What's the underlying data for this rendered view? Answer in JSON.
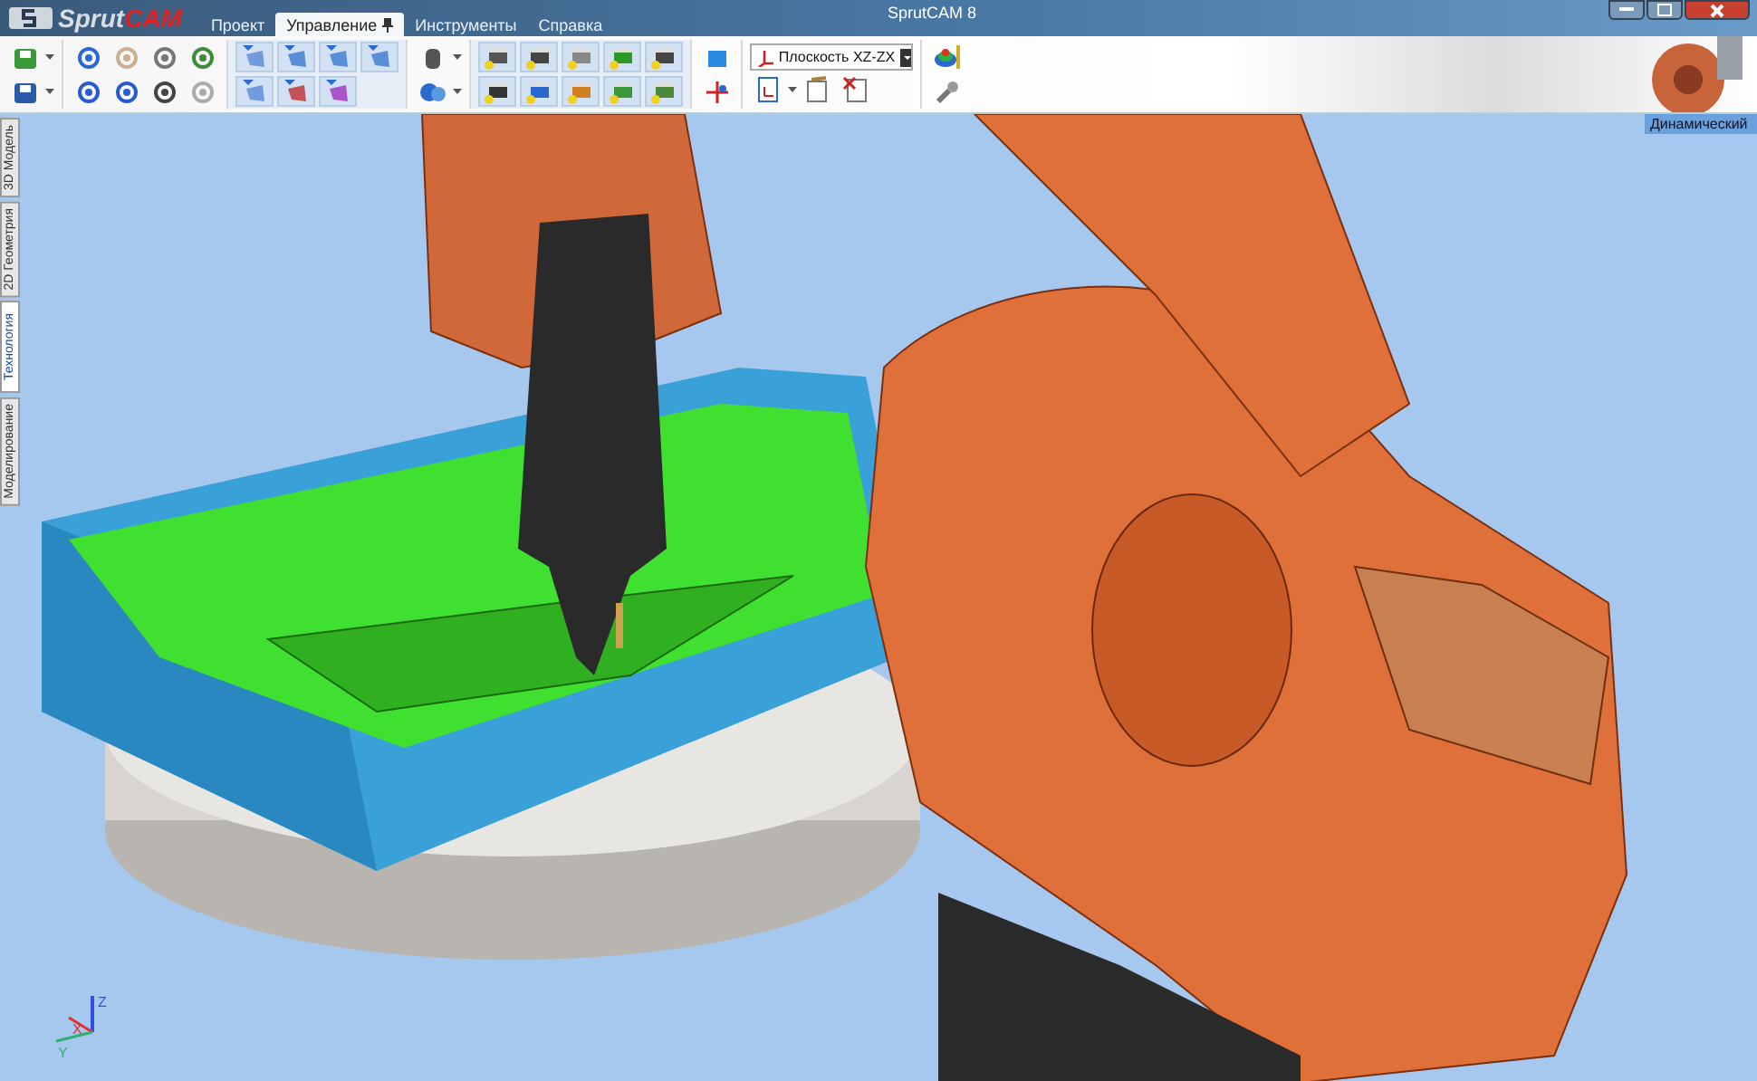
{
  "window": {
    "title": "SprutCAM 8",
    "logo": {
      "part_1": "Sprut",
      "part_2": "CAM"
    }
  },
  "menu_tabs": [
    {
      "label": "Проект",
      "selected": false
    },
    {
      "label": "Управление",
      "selected": true
    },
    {
      "label": "Инструменты",
      "selected": false
    },
    {
      "label": "Справка",
      "selected": false
    }
  ],
  "plane_dropdown": {
    "value": "Плоскость XZ-ZX"
  },
  "side_tabs": [
    {
      "label": "3D Модель",
      "selected": false
    },
    {
      "label": "2D Геометрия",
      "selected": false
    },
    {
      "label": "Технология",
      "selected": true
    },
    {
      "label": "Моделирование",
      "selected": false
    }
  ],
  "view_mode": {
    "value": "Динамический"
  },
  "axes": {
    "z": "Z",
    "x": "X",
    "y": "Y"
  }
}
